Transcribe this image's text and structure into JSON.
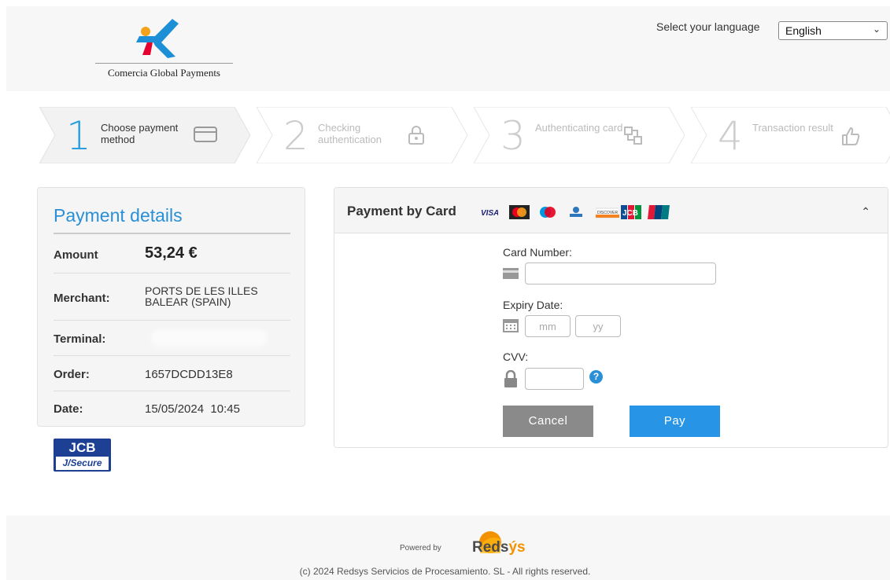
{
  "header": {
    "logo_text": "Comercia Global Payments",
    "language_label": "Select your language",
    "language_selected": "English"
  },
  "steps": [
    {
      "num": "1",
      "label": "Choose payment method",
      "icon": "card-icon",
      "active": true
    },
    {
      "num": "2",
      "label": "Checking authentication",
      "icon": "lock-icon",
      "active": false
    },
    {
      "num": "3",
      "label": "Authenticating card",
      "icon": "network-icon",
      "active": false
    },
    {
      "num": "4",
      "label": "Transaction result",
      "icon": "thumbs-up-icon",
      "active": false
    }
  ],
  "details": {
    "title": "Payment details",
    "amount_label": "Amount",
    "amount_value": "53,24 €",
    "merchant_label": "Merchant:",
    "merchant_line1": "PORTS DE LES ILLES",
    "merchant_line2": "BALEAR (SPAIN)",
    "terminal_label": "Terminal:",
    "order_label": "Order:",
    "order_value": "1657DCDD13E8",
    "date_label": "Date:",
    "date_value": "15/05/2024  10:45"
  },
  "jcb_badge": {
    "top": "JCB",
    "bottom": "J/Secure"
  },
  "card": {
    "title": "Payment by Card",
    "brands": [
      "VISA",
      "Mastercard",
      "Maestro",
      "Amex",
      "Discover",
      "JCB",
      "UnionPay"
    ],
    "card_number_label": "Card Number:",
    "card_number_value": "",
    "expiry_label": "Expiry Date:",
    "expiry_mm_placeholder": "mm",
    "expiry_yy_placeholder": "yy",
    "cvv_label": "CVV:",
    "cvv_value": "",
    "help_glyph": "?",
    "cancel_label": "Cancel",
    "pay_label": "Pay"
  },
  "footer": {
    "powered_by": "Powered by",
    "brand_main": "Reds",
    "brand_accent": "ýs",
    "copyright": "(c) 2024 Redsys Servicios de Procesamiento. SL - All rights reserved."
  },
  "colors": {
    "accent_blue": "#2a8fd6",
    "pay_button": "#2894e6",
    "cancel_button": "#8a8a8a",
    "redsys_orange": "#f39200"
  }
}
